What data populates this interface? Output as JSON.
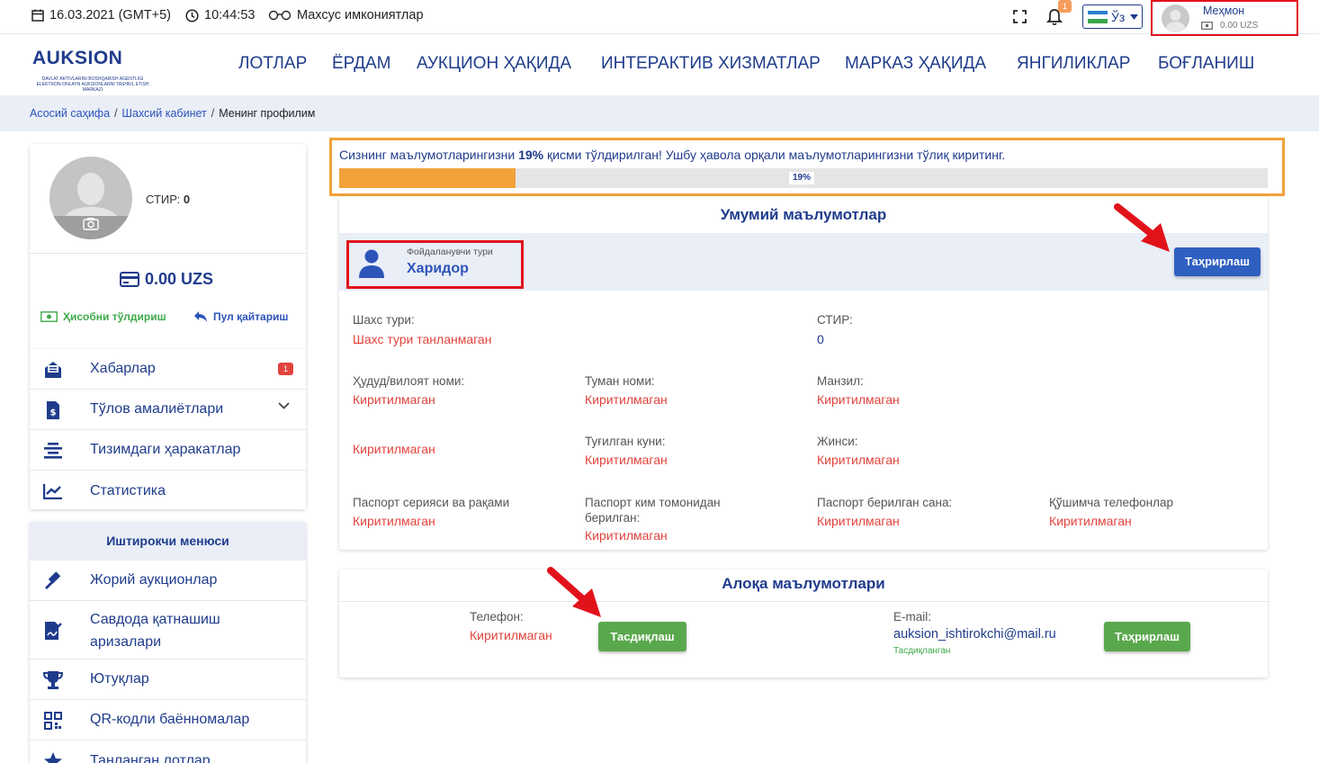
{
  "topbar": {
    "date": "16.03.2021 (GMT+5)",
    "time": "10:44:53",
    "special": "Махсус имкониятлар",
    "notif_count": "1",
    "lang": "Ўз",
    "user_name": "Меҳмон",
    "user_balance": "0.00 UZS"
  },
  "header": {
    "logo_text": "AUKSION",
    "logo_sub": "DAVLAT AKTIVLARINI BOSHQARISH AGENTLIGI ELEKTRON-ONLAYN AUKSIONLARNI TASHKIL ETISH MARKAZI",
    "nav": [
      "ЛОТЛАР",
      "ЁРДАМ",
      "АУКЦИОН ҲАҚИДА",
      "ИНТЕРАКТИВ ХИЗМАТЛАР",
      "МАРКАЗ ҲАҚИДА",
      "ЯНГИЛИКЛАР",
      "БОҒЛАНИШ"
    ]
  },
  "breadcrumb": {
    "home": "Асосий саҳифа",
    "cabinet": "Шахсий кабинет",
    "current": "Менинг профилим"
  },
  "sidebar": {
    "stir_label": "СТИР:",
    "stir_value": "0",
    "balance": "0.00 UZS",
    "topup": "Ҳисобни тўлдириш",
    "refund": "Пул қайтариш",
    "menu": [
      {
        "label": "Хабарлар",
        "badge": "1"
      },
      {
        "label": "Тўлов амалиётлари"
      },
      {
        "label": "Тизимдаги ҳаракатлар"
      },
      {
        "label": "Статистика"
      }
    ],
    "participant_title": "Иштирокчи менюси",
    "participant_menu": [
      {
        "label": "Жорий аукционлар"
      },
      {
        "label": "Савдода қатнашиш",
        "label2": "аризалари"
      },
      {
        "label": "Ютуқлар"
      },
      {
        "label": "QR-кодли баённомалар"
      },
      {
        "label": "Танланган лотлар"
      }
    ]
  },
  "progress": {
    "prefix": "Сизнинг маълумотларингизни ",
    "percent_text": "19%",
    "suffix": " қисми тўлдирилган! Ушбу ҳавола орқали маълумотларингизни тўлиқ киритинг.",
    "percent_value": 19,
    "bar_label": "19%"
  },
  "general": {
    "title": "Умумий маълумотлар",
    "user_type_label": "Фойдаланувчи тури",
    "user_type_value": "Харидор",
    "edit_button": "Таҳрирлаш",
    "fields": {
      "person_type_label": "Шахс тури:",
      "person_type_value": "Шахс тури танланмаган",
      "stir_label": "СТИР:",
      "stir_value": "0",
      "region_label": "Ҳудуд/вилоят номи:",
      "region_value": "Киритилмаган",
      "district_label": "Туман номи:",
      "district_value": "Киритилмаган",
      "address_label": "Манзил:",
      "address_value": "Киритилмаган",
      "extra_value": "Киритилмаган",
      "birth_label": "Туғилган куни:",
      "birth_value": "Киритилмаган",
      "gender_label": "Жинси:",
      "gender_value": "Киритилмаган",
      "passport_label": "Паспорт серияси ва рақами",
      "passport_value": "Киритилмаган",
      "issuer_label": "Паспорт ким томонидан берилган:",
      "issuer_value": "Киритилмаган",
      "issue_date_label": "Паспорт берилган сана:",
      "issue_date_value": "Киритилмаган",
      "phones_label": "Қўшимча телефонлар",
      "phones_value": "Киритилмаган"
    }
  },
  "contact": {
    "title": "Алоқа маълумотлари",
    "phone_label": "Телефон:",
    "phone_value": "Киритилмаган",
    "confirm_button": "Тасдиқлаш",
    "email_label": "E-mail:",
    "email_value": "auksion_ishtirokchi@mail.ru",
    "email_status": "Тасдиқланган",
    "edit_button": "Таҳрирлаш"
  },
  "colors": {
    "brand": "#1f3c8c",
    "link": "#2d54b8",
    "accent_orange": "#f2a23b",
    "highlight_red": "#e2121b",
    "danger_text": "#e2433c",
    "success": "#5aa84d"
  }
}
